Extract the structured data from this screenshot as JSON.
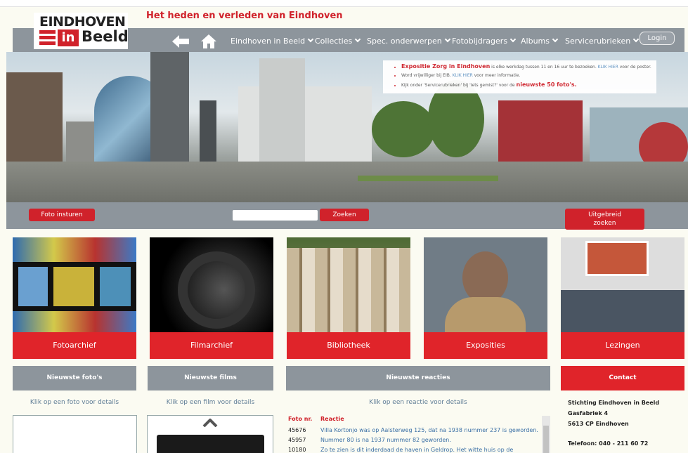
{
  "site": {
    "tagline": "Het heden en verleden van Eindhoven",
    "logo_line1": "EINDHOVEN",
    "logo_in": "in",
    "logo_beeld": "Beeld"
  },
  "nav": {
    "items": [
      {
        "label": "Eindhoven in Beeld"
      },
      {
        "label": "Collecties"
      },
      {
        "label": "Spec. onderwerpen"
      },
      {
        "label": "Fotobijdragers"
      },
      {
        "label": "Albums"
      },
      {
        "label": "Servicerubrieken"
      }
    ],
    "login": "Login"
  },
  "info": {
    "line1_red": "Expositie Zorg in Eindhoven",
    "line1_text": " is elke werkdag tussen 11 en 16 uur te bezoeken. ",
    "line1_link": "KLIK HIER",
    "line1_tail": " voor de poster.",
    "line2_text": "Word vrijwilliger bij EIB. ",
    "line2_link": "KLIK HIER",
    "line2_tail": " voor meer informatie.",
    "line3_text": "Kijk onder 'Servicerubrieken' bij 'Iets gemist?' voor de ",
    "line3_red": "nieuwste 50 foto's."
  },
  "actions": {
    "foto_insturen": "Foto insturen",
    "zoeken": "Zoeken",
    "uitgebreid_1": "Uitgebreid",
    "uitgebreid_2": "zoeken"
  },
  "tiles": [
    {
      "label": "Fotoarchief"
    },
    {
      "label": "Filmarchief"
    },
    {
      "label": "Bibliotheek"
    },
    {
      "label": "Exposities"
    },
    {
      "label": "Lezingen"
    }
  ],
  "columns": {
    "fotos": {
      "title": "Nieuwste foto's",
      "hint": "Klik op een foto voor details"
    },
    "films": {
      "title": "Nieuwste films",
      "hint": "Klik op een film voor details"
    },
    "reacties": {
      "title": "Nieuwste reacties",
      "hint": "Klik op een reactie voor details",
      "col_nr": "Foto nr.",
      "col_reactie": "Reactie",
      "rows": [
        {
          "nr": "45676",
          "text": "Villa Kortonjo was op Aalsterweg 125, dat na 1938 nummer 237 is geworden."
        },
        {
          "nr": "45957",
          "text": "Nummer 80 is na 1937 nummer 82 geworden."
        },
        {
          "nr": "10180",
          "text": "Zo te zien is dit inderdaad de haven in Geldrop. Het witte huis op de"
        }
      ]
    },
    "contact": {
      "title": "Contact",
      "lines": [
        "Stichting Eindhoven in Beeld",
        "Gasfabriek 4",
        "5613 CP Eindhoven",
        "Telefoon: 040 - 211 60 72"
      ]
    }
  }
}
